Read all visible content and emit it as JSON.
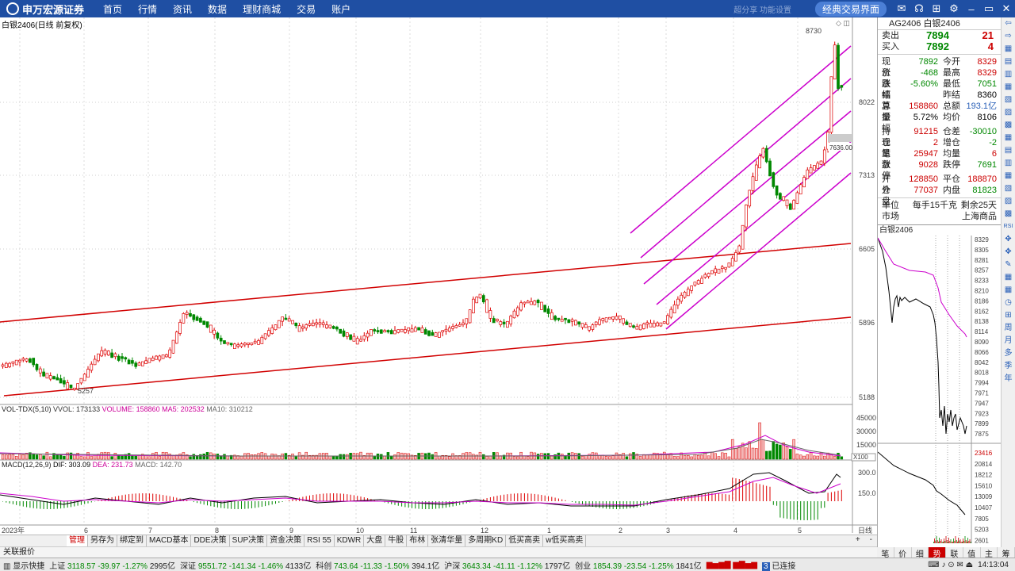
{
  "topbar": {
    "logo": "申万宏源证券",
    "nav": [
      "首页",
      "行情",
      "资讯",
      "数据",
      "理财商城",
      "交易",
      "账户"
    ],
    "faint": "超分享 功能设置",
    "classic": "经典交易界面"
  },
  "chart": {
    "title": "白银2406(日线 前复权)",
    "ticks": [
      "8022",
      "7313",
      "6605",
      "5896",
      "5188"
    ],
    "high_label": "8730",
    "low_label": "5257",
    "price_tag": "7636.00",
    "vol_header": {
      "a": "VOL-TDX(5,10)",
      "b": "VVOL: 173133",
      "c": "VOLUME: 158860",
      "d": "MA5: 202532",
      "e": "MA10: 310212"
    },
    "vol_ticks": [
      "45000",
      "30000",
      "15000"
    ],
    "vol_unit": "X100",
    "macd_header": {
      "a": "MACD(12,26,9)",
      "b": "DIF: 303.09",
      "c": "DEA: 231.73",
      "d": "MACD: 142.70"
    },
    "macd_ticks": [
      "300.0",
      "150.0"
    ],
    "months": [
      "2023年",
      "6",
      "7",
      "8",
      "9",
      "10",
      "11",
      "12",
      "1",
      "2",
      "3",
      "4",
      "5"
    ],
    "period": "日线"
  },
  "tabs": [
    "管理",
    "另存为",
    "绑定到",
    "MACD基本",
    "DDE决策",
    "SUP决策",
    "资金决策",
    "RSI 55",
    "KDWR",
    "大盘",
    "牛股",
    "布林",
    "张清华量",
    "多周期KD",
    "低买高卖",
    "w低买高卖"
  ],
  "link_label": "关联报价",
  "quote": {
    "code": "AG2406",
    "name": "白银2406",
    "sell": {
      "l": "卖出",
      "p": "7894",
      "q": "21"
    },
    "buy": {
      "l": "买入",
      "p": "7892",
      "q": "4"
    },
    "rows": [
      [
        "现价",
        "7892",
        "今开",
        "8329"
      ],
      [
        "涨跌",
        "-468",
        "最高",
        "8329"
      ],
      [
        "涨幅",
        "-5.60%",
        "最低",
        "7051"
      ],
      [
        "结算",
        "",
        "昨结",
        "8360"
      ],
      [
        "总量",
        "158860",
        "总额",
        "193.1亿"
      ],
      [
        "振幅",
        "5.72%",
        "均价",
        "8106"
      ],
      [
        "持仓",
        "91215",
        "仓差",
        "-30010"
      ],
      [
        "现量",
        "2",
        "增仓",
        "-2"
      ],
      [
        "笔数",
        "25947",
        "均量",
        "6"
      ],
      [
        "涨停",
        "9028",
        "跌停",
        "7691"
      ],
      [
        "开仓",
        "128850",
        "平仓",
        "188870"
      ],
      [
        "外盘",
        "77037",
        "内盘",
        "81823"
      ]
    ],
    "unit_l": "单位",
    "unit_v": "每手15千克",
    "remain": "剩余25天",
    "market_l": "市场",
    "market_v": "上海商品"
  },
  "mini": {
    "title": "白银2406",
    "ticks": [
      "8329",
      "8305",
      "8281",
      "8257",
      "8233",
      "8210",
      "8186",
      "8162",
      "8138",
      "8114",
      "8090",
      "8066",
      "8042",
      "8018",
      "7994",
      "7971",
      "7947",
      "7923",
      "7899",
      "7875"
    ],
    "vticks": [
      "23416",
      "20814",
      "18212",
      "15610",
      "13009",
      "10407",
      "7805",
      "5203",
      "2601"
    ]
  },
  "bottom_tabs": [
    "笔",
    "价",
    "细",
    "势",
    "联",
    "值",
    "主",
    "筹"
  ],
  "status": {
    "show": "显示快捷",
    "sh": "上证",
    "sh_v": "3118.57",
    "sh_c": "-39.97",
    "sh_p": "-1.27%",
    "sh_a": "2995亿",
    "sz": "深证",
    "sz_v": "9551.72",
    "sz_c": "-141.34",
    "sz_p": "-1.46%",
    "sz_a": "4133亿",
    "kc": "科创",
    "kc_v": "743.64",
    "kc_c": "-11.33",
    "kc_p": "-1.50%",
    "kc_a": "394.1亿",
    "hs": "沪深",
    "hs_v": "3643.34",
    "hs_c": "-41.11",
    "hs_p": "-1.12%",
    "hs_a": "1797亿",
    "cy": "创业",
    "cy_v": "1854.39",
    "cy_c": "-23.54",
    "cy_p": "-1.25%",
    "cy_a": "1841亿",
    "conn": "已连接",
    "num": "3",
    "time": "14:13:04"
  },
  "rtool": [
    "⇦",
    "⇨",
    "▦",
    "▤",
    "▥",
    "▦",
    "▧",
    "▨",
    "▩",
    "▦",
    "▤",
    "▥",
    "▦",
    "▧",
    "▨",
    "▩",
    "RSI",
    "✥",
    "✥",
    "✎",
    "▦",
    "▦",
    "◷",
    "⊞",
    "周",
    "月",
    "多",
    "季",
    "年"
  ]
}
